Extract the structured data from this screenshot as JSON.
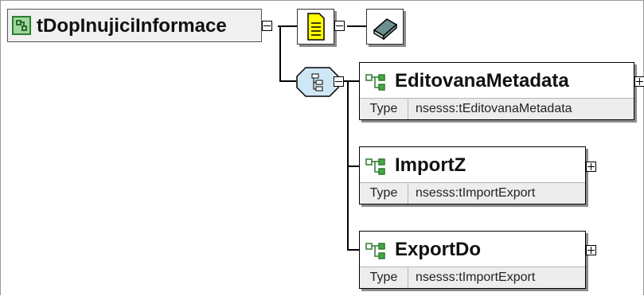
{
  "diagram": {
    "root": {
      "name": "tDopInujiciInformace",
      "icon": "complex-type-icon"
    },
    "annotation_icon": "documentation-icon",
    "extension_icon": "extension-book-icon",
    "compositor_icon": "sequence-icon",
    "elements": [
      {
        "name": "EditovanaMetadata",
        "type_label": "Type",
        "type_value": "nsesss:tEditovanaMetadata"
      },
      {
        "name": "ImportZ",
        "type_label": "Type",
        "type_value": "nsesss:tImportExport"
      },
      {
        "name": "ExportDo",
        "type_label": "Type",
        "type_value": "nsesss:tImportExport"
      }
    ],
    "colors": {
      "root_icon": "#9fd89f",
      "doc_icon": "#ffff00",
      "sequence": "#cfe6f5",
      "element_icon": "#44aa44"
    }
  }
}
